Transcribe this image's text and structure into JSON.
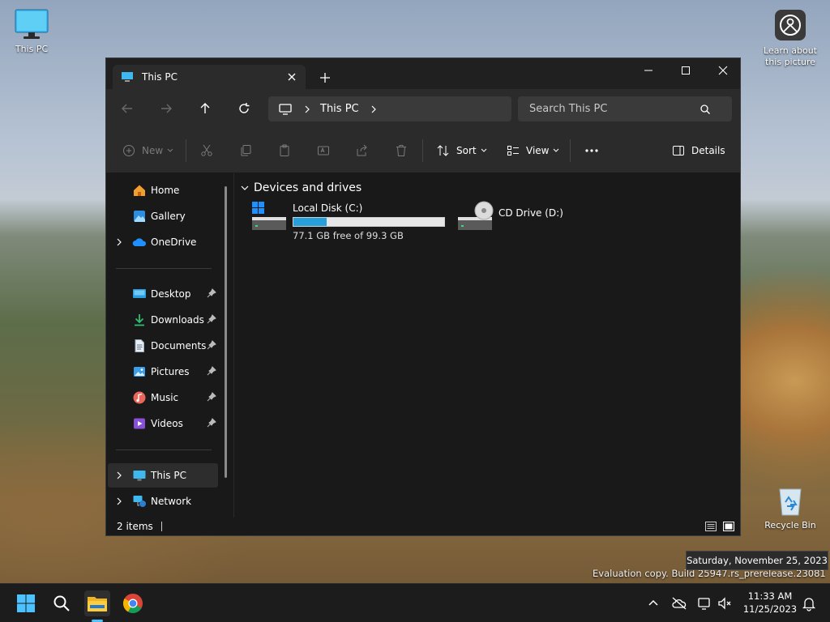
{
  "desktop": {
    "this_pc_label": "This PC",
    "learn_label": "Learn about this picture",
    "recycle_label": "Recycle Bin"
  },
  "window": {
    "tab_title": "This PC",
    "breadcrumb": "This PC",
    "search_placeholder": "Search This PC",
    "toolbar": {
      "new_label": "New",
      "sort_label": "Sort",
      "view_label": "View",
      "details_label": "Details"
    },
    "sidebar": {
      "home": "Home",
      "gallery": "Gallery",
      "onedrive": "OneDrive",
      "desktop": "Desktop",
      "downloads": "Downloads",
      "documents": "Documents",
      "pictures": "Pictures",
      "music": "Music",
      "videos": "Videos",
      "this_pc": "This PC",
      "network": "Network"
    },
    "content": {
      "group_title": "Devices and drives",
      "drive_c": {
        "name": "Local Disk (C:)",
        "free_text": "77.1 GB free of 99.3 GB",
        "used_fraction": 0.22
      },
      "drive_d": {
        "name": "CD Drive (D:)"
      }
    },
    "status": {
      "items": "2 items"
    }
  },
  "taskbar": {
    "time": "11:33 AM",
    "date": "11/25/2023",
    "tooltip": "Saturday, November 25, 2023",
    "watermark": "Evaluation copy. Build 25947.rs_prerelease.23081"
  },
  "colors": {
    "accent": "#26a0da",
    "window_bg": "#191919",
    "chrome_bg": "#2b2b2b",
    "taskbar_bg": "#1c1c1c"
  }
}
